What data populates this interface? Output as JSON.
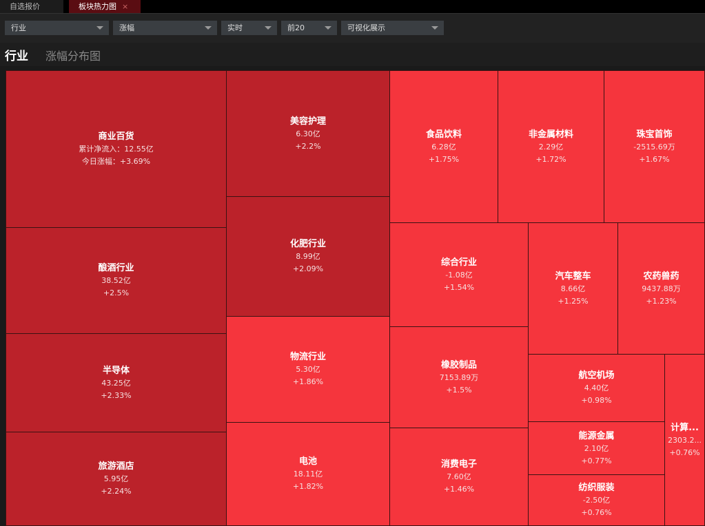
{
  "tabs": [
    {
      "label": "自选报价"
    },
    {
      "label": "板块热力图",
      "close": "×"
    }
  ],
  "filters": [
    "行业",
    "涨幅",
    "实时",
    "前20",
    "可视化展示"
  ],
  "header": {
    "title": "行业",
    "subtitle": "涨幅分布图"
  },
  "colors": {
    "dark": "#bb222a",
    "bright": "#f5353d"
  },
  "cells": [
    {
      "name": "商业百货",
      "line2": "累计净流入：12.55亿",
      "line3": "今日涨幅：+3.69%",
      "shade": "dark"
    },
    {
      "name": "酿酒行业",
      "line2": "38.52亿",
      "line3": "+2.5%",
      "shade": "dark"
    },
    {
      "name": "半导体",
      "line2": "43.25亿",
      "line3": "+2.33%",
      "shade": "dark"
    },
    {
      "name": "旅游酒店",
      "line2": "5.95亿",
      "line3": "+2.24%",
      "shade": "dark"
    },
    {
      "name": "美容护理",
      "line2": "6.30亿",
      "line3": "+2.2%",
      "shade": "dark"
    },
    {
      "name": "化肥行业",
      "line2": "8.99亿",
      "line3": "+2.09%",
      "shade": "dark"
    },
    {
      "name": "物流行业",
      "line2": "5.30亿",
      "line3": "+1.86%",
      "shade": "bright"
    },
    {
      "name": "电池",
      "line2": "18.11亿",
      "line3": "+1.82%",
      "shade": "bright"
    },
    {
      "name": "食品饮料",
      "line2": "6.28亿",
      "line3": "+1.75%",
      "shade": "bright"
    },
    {
      "name": "非金属材料",
      "line2": "2.29亿",
      "line3": "+1.72%",
      "shade": "bright"
    },
    {
      "name": "珠宝首饰",
      "line2": "-2515.69万",
      "line3": "+1.67%",
      "shade": "bright"
    },
    {
      "name": "综合行业",
      "line2": "-1.08亿",
      "line3": "+1.54%",
      "shade": "bright"
    },
    {
      "name": "橡胶制品",
      "line2": "7153.89万",
      "line3": "+1.5%",
      "shade": "bright"
    },
    {
      "name": "消费电子",
      "line2": "7.60亿",
      "line3": "+1.46%",
      "shade": "bright"
    },
    {
      "name": "汽车整车",
      "line2": "8.66亿",
      "line3": "+1.25%",
      "shade": "bright"
    },
    {
      "name": "农药兽药",
      "line2": "9437.88万",
      "line3": "+1.23%",
      "shade": "bright"
    },
    {
      "name": "航空机场",
      "line2": "4.40亿",
      "line3": "+0.98%",
      "shade": "bright"
    },
    {
      "name": "能源金属",
      "line2": "2.10亿",
      "line3": "+0.77%",
      "shade": "bright"
    },
    {
      "name": "纺织服装",
      "line2": "-2.50亿",
      "line3": "+0.76%",
      "shade": "bright"
    },
    {
      "name": "计算...",
      "line2": "2303.2...",
      "line3": "+0.76%",
      "shade": "bright"
    }
  ]
}
